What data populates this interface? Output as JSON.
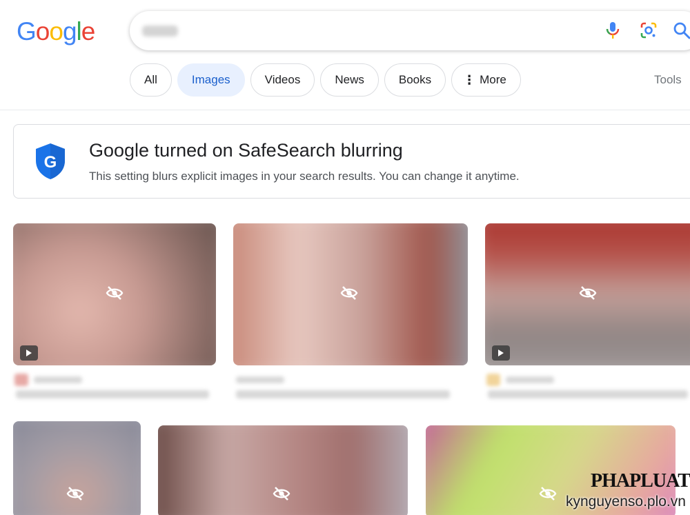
{
  "logo": {
    "letters": [
      "G",
      "o",
      "o",
      "g",
      "l",
      "e"
    ],
    "colors": [
      "#4285f4",
      "#ea4335",
      "#fbbc05",
      "#4285f4",
      "#34a853",
      "#ea4335"
    ]
  },
  "search": {
    "icons": [
      "mic-icon",
      "lens-icon",
      "search-icon"
    ]
  },
  "tabs": [
    {
      "label": "All",
      "active": false
    },
    {
      "label": "Images",
      "active": true
    },
    {
      "label": "Videos",
      "active": false
    },
    {
      "label": "News",
      "active": false
    },
    {
      "label": "Books",
      "active": false
    },
    {
      "label": "More",
      "active": false
    }
  ],
  "tools_label": "Tools",
  "safesearch": {
    "title": "Google turned on SafeSearch blurring",
    "text": "This setting blurs explicit images in your search results. You can change it anytime."
  },
  "results": [
    {
      "state": "blurred",
      "icon": "eye-off-icon",
      "video": true,
      "colors": [
        "#b58c85",
        "#d9aaa1",
        "#6d5a54"
      ]
    },
    {
      "state": "blurred",
      "icon": "eye-off-icon",
      "video": false,
      "colors": [
        "#c58b7c",
        "#e5c7c0",
        "#9a6f68"
      ]
    },
    {
      "state": "blurred",
      "icon": "eye-off-icon",
      "video": true,
      "colors": [
        "#a2302c",
        "#c9a09b",
        "#8a7a78"
      ]
    },
    {
      "state": "blurred",
      "icon": "eye-off-icon",
      "video": false,
      "colors": [
        "#8e8f9c",
        "#c49c95",
        "#a7a1a2"
      ]
    },
    {
      "state": "blurred",
      "icon": "eye-off-icon",
      "video": false,
      "colors": [
        "#6a4a44",
        "#c9a6a2",
        "#a37d79"
      ]
    },
    {
      "state": "blurred",
      "icon": "eye-off-icon",
      "video": false,
      "colors": [
        "#c9e07a",
        "#d98fc4",
        "#e9b28f"
      ]
    }
  ],
  "watermark": {
    "logo": "PHAPLUAT",
    "site": "kynguyenso.plo.vn"
  }
}
